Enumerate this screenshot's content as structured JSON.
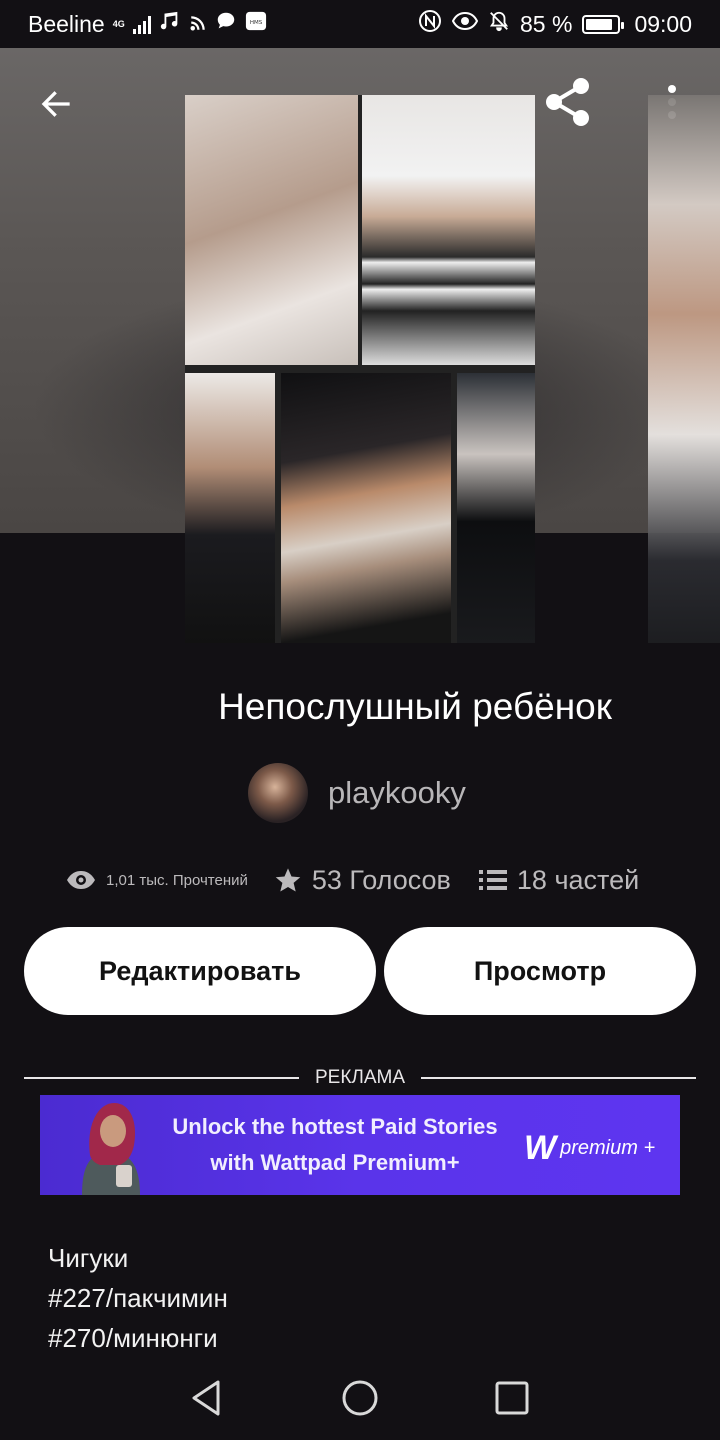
{
  "status_bar": {
    "carrier": "Beeline",
    "network": "4G",
    "battery": "85 %",
    "battery_level": 0.85,
    "time": "09:00",
    "icons": [
      "signal-icon",
      "music-icon",
      "cast-icon",
      "chat-icon",
      "hms-icon",
      "nfc-icon",
      "eye-icon",
      "bell-off-icon",
      "battery-icon"
    ]
  },
  "header": {
    "back_icon": "arrow-left-icon",
    "share_icon": "share-icon",
    "more_icon": "more-vertical-icon"
  },
  "story": {
    "title": "Непослушный ребёнок",
    "author": "playkooky",
    "stats": {
      "reads": "1,01 тыс. Прочтений",
      "votes": "53 Голосов",
      "parts": "18 частей"
    }
  },
  "actions": {
    "edit_label": "Редактировать",
    "view_label": "Просмотр"
  },
  "ad": {
    "label": "РЕКЛАМА",
    "line1": "Unlock the hottest Paid Stories",
    "line2": "with Wattpad Premium+",
    "logo_mark": "W",
    "logo_text": "premium +"
  },
  "tags": [
    "Чигуки",
    "#227/пакчимин",
    "#270/минюнги"
  ],
  "colors": {
    "background": "#121014",
    "button_bg": "#ffffff",
    "ad_bg": "#5a34ea",
    "muted_text": "#bcbabc"
  }
}
